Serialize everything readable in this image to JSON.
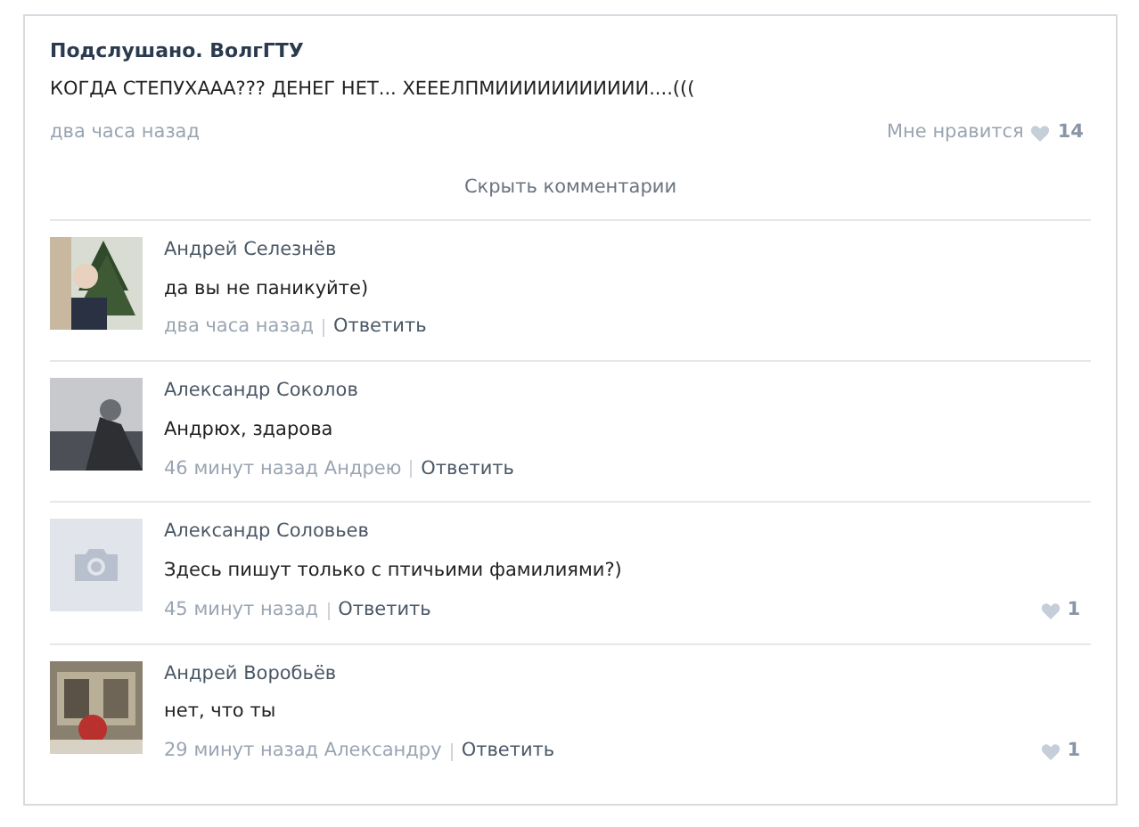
{
  "post": {
    "author": "Подслушано. ВолгГТУ",
    "text": "КОГДА СТЕПУХААА??? ДЕНЕГ НЕТ... ХЕЕЕЛПМИИИИИИИИИИИ....(((",
    "time": "два часа назад",
    "like_label": "Мне нравится",
    "likes": "14"
  },
  "hide_comments": "Скрыть комментарии",
  "comments": [
    {
      "name": "Андрей Селезнёв",
      "text": "да вы не паникуйте)",
      "time": "два часа назад",
      "reply": "Ответить"
    },
    {
      "name": "Александр Соколов",
      "text": "Андрюх, здарова",
      "time": "46 минут назад Андрею",
      "reply": "Ответить"
    },
    {
      "avatar": {
        "kind": "placeholder"
      },
      "name": "Александр Соловьев",
      "text": "Здесь пишут только с птичьими фамилиями?)",
      "time": "45 минут назад",
      "reply": "Ответить",
      "likes": "1"
    },
    {
      "name": "Андрей Воробьёв",
      "text": "нет, что ты",
      "time": "29 минут назад Александру",
      "reply": "Ответить",
      "likes": "1"
    }
  ]
}
